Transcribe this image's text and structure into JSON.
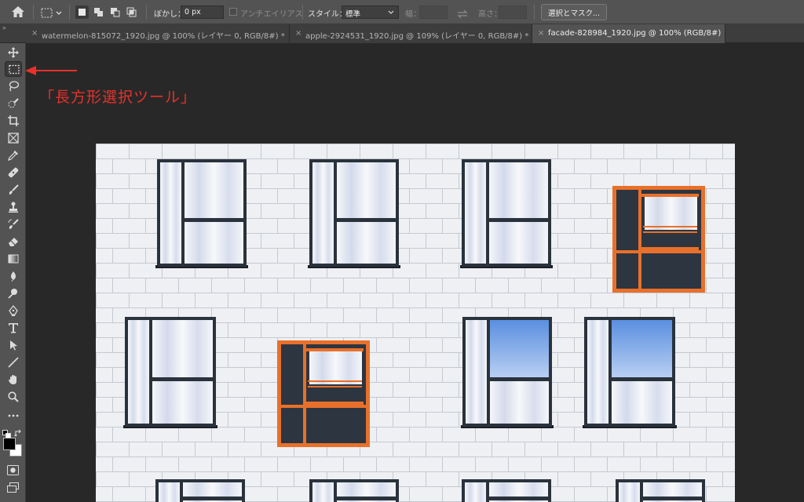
{
  "options": {
    "feather_label": "ぼかし：",
    "feather_value": "0 px",
    "antialias_label": "アンチエイリアス",
    "style_label": "スタイル：",
    "style_value": "標準",
    "width_label": "幅：",
    "height_label": "高さ：",
    "select_mask_button": "選択とマスク..."
  },
  "tabs": [
    {
      "label": "watermelon-815072_1920.jpg @ 100% (レイヤー 0, RGB/8#) *",
      "active": false
    },
    {
      "label": "apple-2924531_1920.jpg @ 109% (レイヤー 0, RGB/8#) *",
      "active": false
    },
    {
      "label": "facade-828984_1920.jpg @ 100% (RGB/8#)",
      "active": true
    }
  ],
  "tools": [
    "move-icon",
    "rectangular-marquee-icon",
    "lasso-icon",
    "quick-selection-icon",
    "crop-icon",
    "frame-icon",
    "eyedropper-icon",
    "healing-brush-icon",
    "brush-icon",
    "clone-stamp-icon",
    "history-brush-icon",
    "eraser-icon",
    "gradient-icon",
    "blur-icon",
    "dodge-icon",
    "pen-icon",
    "type-icon",
    "path-selection-icon",
    "line-icon",
    "hand-icon",
    "zoom-icon",
    "more-tools-icon"
  ],
  "annotation": {
    "text": "「長方形選択ツール」",
    "color": "#e8312a"
  },
  "colors": {
    "foreground": "#000000",
    "background": "#ffffff",
    "window_frame": "#2a323c",
    "accent_frame": "#e8702a"
  }
}
